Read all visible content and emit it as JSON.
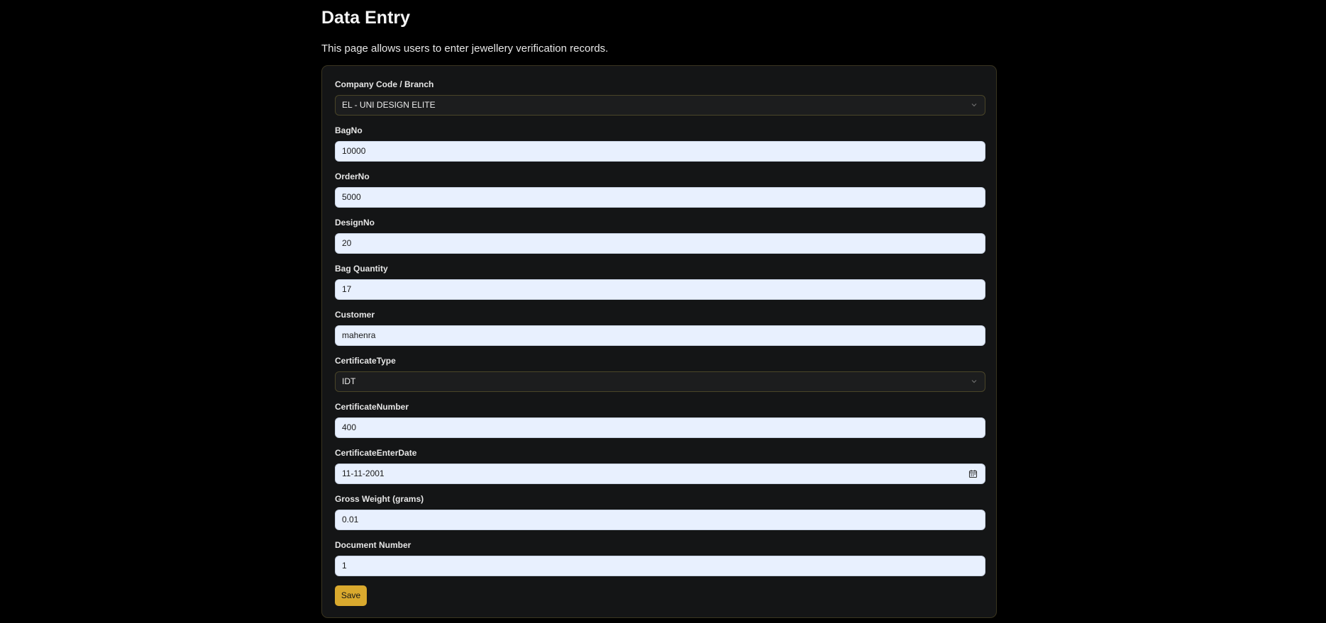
{
  "header": {
    "title": "Data Entry",
    "description": "This page allows users to enter jewellery verification records."
  },
  "form": {
    "company": {
      "label": "Company Code / Branch",
      "value": "EL - UNI DESIGN ELITE"
    },
    "bag_no": {
      "label": "BagNo",
      "value": "10000"
    },
    "order_no": {
      "label": "OrderNo",
      "value": "5000"
    },
    "design_no": {
      "label": "DesignNo",
      "value": "20"
    },
    "bag_quantity": {
      "label": "Bag Quantity",
      "value": "17"
    },
    "customer": {
      "label": "Customer",
      "value": "mahenra"
    },
    "certificate_type": {
      "label": "CertificateType",
      "value": "IDT"
    },
    "certificate_number": {
      "label": "CertificateNumber",
      "value": "400"
    },
    "certificate_enter_date": {
      "label": "CertificateEnterDate",
      "value": "11-11-2001"
    },
    "gross_weight": {
      "label": "Gross Weight (grams)",
      "value": "0.01"
    },
    "document_number": {
      "label": "Document Number",
      "value": "1"
    },
    "save_label": "Save"
  },
  "icons": {
    "select_chevron": "chevron-down-icon",
    "date_picker": "calendar-icon"
  },
  "colors": {
    "background": "#000000",
    "card": "#141516",
    "input_fill": "#e8f0fe",
    "accent": "#d9a92e"
  }
}
